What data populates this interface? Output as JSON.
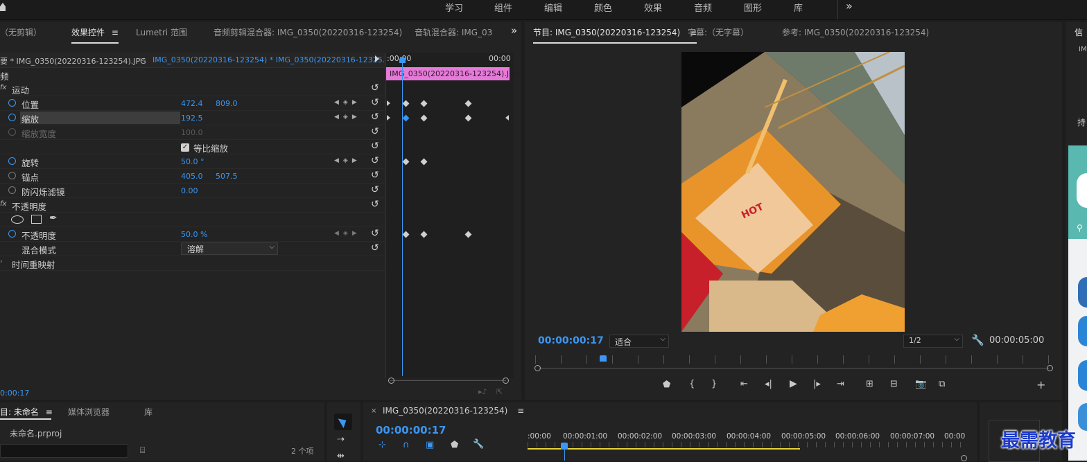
{
  "workspaces": [
    "学习",
    "组件",
    "编辑",
    "颜色",
    "效果",
    "音频",
    "图形",
    "库"
  ],
  "workspaces_more": "»",
  "left_tabs": {
    "no_clip": "（无剪辑）",
    "effect_controls": "效果控件",
    "lumetri": "Lumetri 范围",
    "audio_clip_mixer": "音频剪辑混合器: IMG_0350(20220316-123254)",
    "audio_track_mixer": "音轨混合器: IMG_03",
    "more": "»"
  },
  "effect_controls": {
    "source_label": "要 * IMG_0350(20220316-123254).JPG",
    "sequence_label": "IMG_0350(20220316-123254) * IMG_0350(20220316-12325...",
    "section_video": "频",
    "timeline_start": ":00:00",
    "timeline_end": "00:00",
    "clip_bar_label": "IMG_0350(20220316-123254).JPG",
    "motion": "运动",
    "position": {
      "label": "位置",
      "x": "472.4",
      "y": "809.0"
    },
    "scale": {
      "label": "缩放",
      "value": "192.5"
    },
    "scale_width": {
      "label": "缩放宽度",
      "value": "100.0"
    },
    "uniform_scale": "等比缩放",
    "rotation": {
      "label": "旋转",
      "value": "50.0 °"
    },
    "anchor": {
      "label": "锚点",
      "x": "405.0",
      "y": "507.5"
    },
    "anti_flicker": {
      "label": "防闪烁滤镜",
      "value": "0.00"
    },
    "opacity_section": "不透明度",
    "opacity": {
      "label": "不透明度",
      "value": "50.0 %"
    },
    "blend_mode": {
      "label": "混合模式",
      "value": "溶解"
    },
    "time_remap": "时间重映射",
    "current_time": "0:00:17"
  },
  "program_monitor": {
    "tab_program": "节目: IMG_0350(20220316-123254)",
    "tab_captions": "字幕:（无字幕）",
    "tab_reference": "参考: IMG_0350(20220316-123254)",
    "timecode": "00:00:00:17",
    "fit": "适合",
    "resolution": "1/2",
    "duration": "00:00:05:00",
    "photo_text": "HOT"
  },
  "right_panel": {
    "tab": "信",
    "text1": "IM",
    "text2": "持"
  },
  "project_panel": {
    "tab_project": "目: 未命名",
    "tab_media": "媒体浏览器",
    "tab_library": "库",
    "project_file": "未命名.prproj",
    "item_count": "2 个项"
  },
  "timeline": {
    "sequence_name": "IMG_0350(20220316-123254)",
    "timecode": "00:00:00:17",
    "ruler": [
      ":00:00",
      "00:00:01:00",
      "00:00:02:00",
      "00:00:03:00",
      "00:00:04:00",
      "00:00:05:00",
      "00:00:06:00",
      "00:00:07:00",
      "00:00"
    ]
  },
  "watermark": "最需教育"
}
